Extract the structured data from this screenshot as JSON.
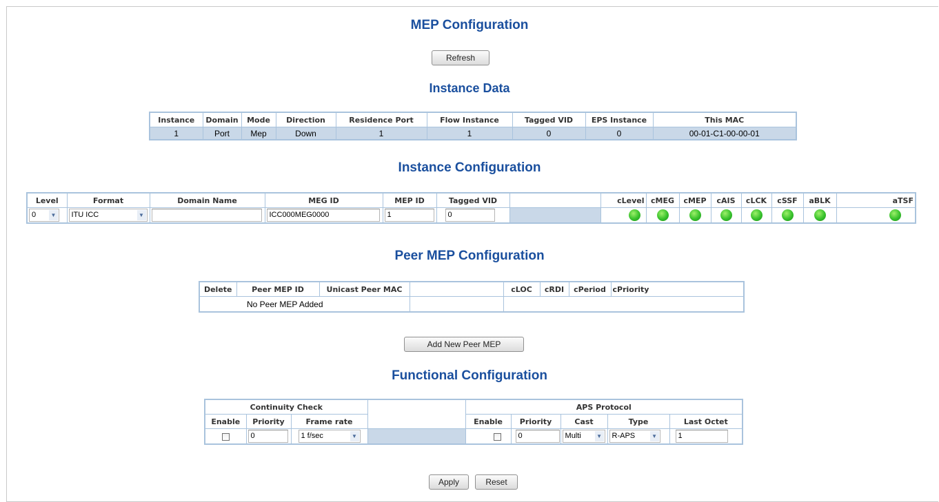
{
  "titles": {
    "main": "MEP Configuration",
    "instance_data": "Instance Data",
    "instance_config": "Instance Configuration",
    "peer_mep_config": "Peer MEP Configuration",
    "functional_config": "Functional Configuration"
  },
  "buttons": {
    "refresh": "Refresh",
    "add_peer": "Add New Peer MEP",
    "apply": "Apply",
    "reset": "Reset"
  },
  "instance_data": {
    "headers": [
      "Instance",
      "Domain",
      "Mode",
      "Direction",
      "Residence Port",
      "Flow Instance",
      "Tagged VID",
      "EPS Instance",
      "This MAC"
    ],
    "row": [
      "1",
      "Port",
      "Mep",
      "Down",
      "1",
      "1",
      "0",
      "0",
      "00-01-C1-00-00-01"
    ]
  },
  "instance_config": {
    "headers": [
      "Level",
      "Format",
      "Domain Name",
      "MEG ID",
      "MEP ID",
      "Tagged VID",
      "",
      "cLevel",
      "cMEG",
      "cMEP",
      "cAIS",
      "cLCK",
      "cSSF",
      "aBLK",
      "aTSF"
    ],
    "level": "0",
    "format": "ITU ICC",
    "domain_name": "",
    "meg_id": "ICC000MEG0000",
    "mep_id": "1",
    "tagged_vid": "0",
    "led_color": "#37c12b"
  },
  "peer_mep": {
    "headers": [
      "Delete",
      "Peer MEP ID",
      "Unicast Peer MAC",
      "",
      "cLOC",
      "cRDI",
      "cPeriod",
      "cPriority"
    ],
    "empty_message": "No Peer MEP Added"
  },
  "functional": {
    "group_cc": "Continuity Check",
    "group_aps": "APS Protocol",
    "cc_headers": [
      "Enable",
      "Priority",
      "Frame rate"
    ],
    "aps_headers": [
      "Enable",
      "Priority",
      "Cast",
      "Type",
      "Last Octet"
    ],
    "cc_priority": "0",
    "cc_frame_rate": "1 f/sec",
    "aps_priority": "0",
    "aps_cast": "Multi",
    "aps_type": "R-APS",
    "aps_last_octet": "1"
  },
  "colors": {
    "heading": "#1a4f9e",
    "table_border": "#a9c3dd",
    "row_fill": "#c9d8e8"
  }
}
